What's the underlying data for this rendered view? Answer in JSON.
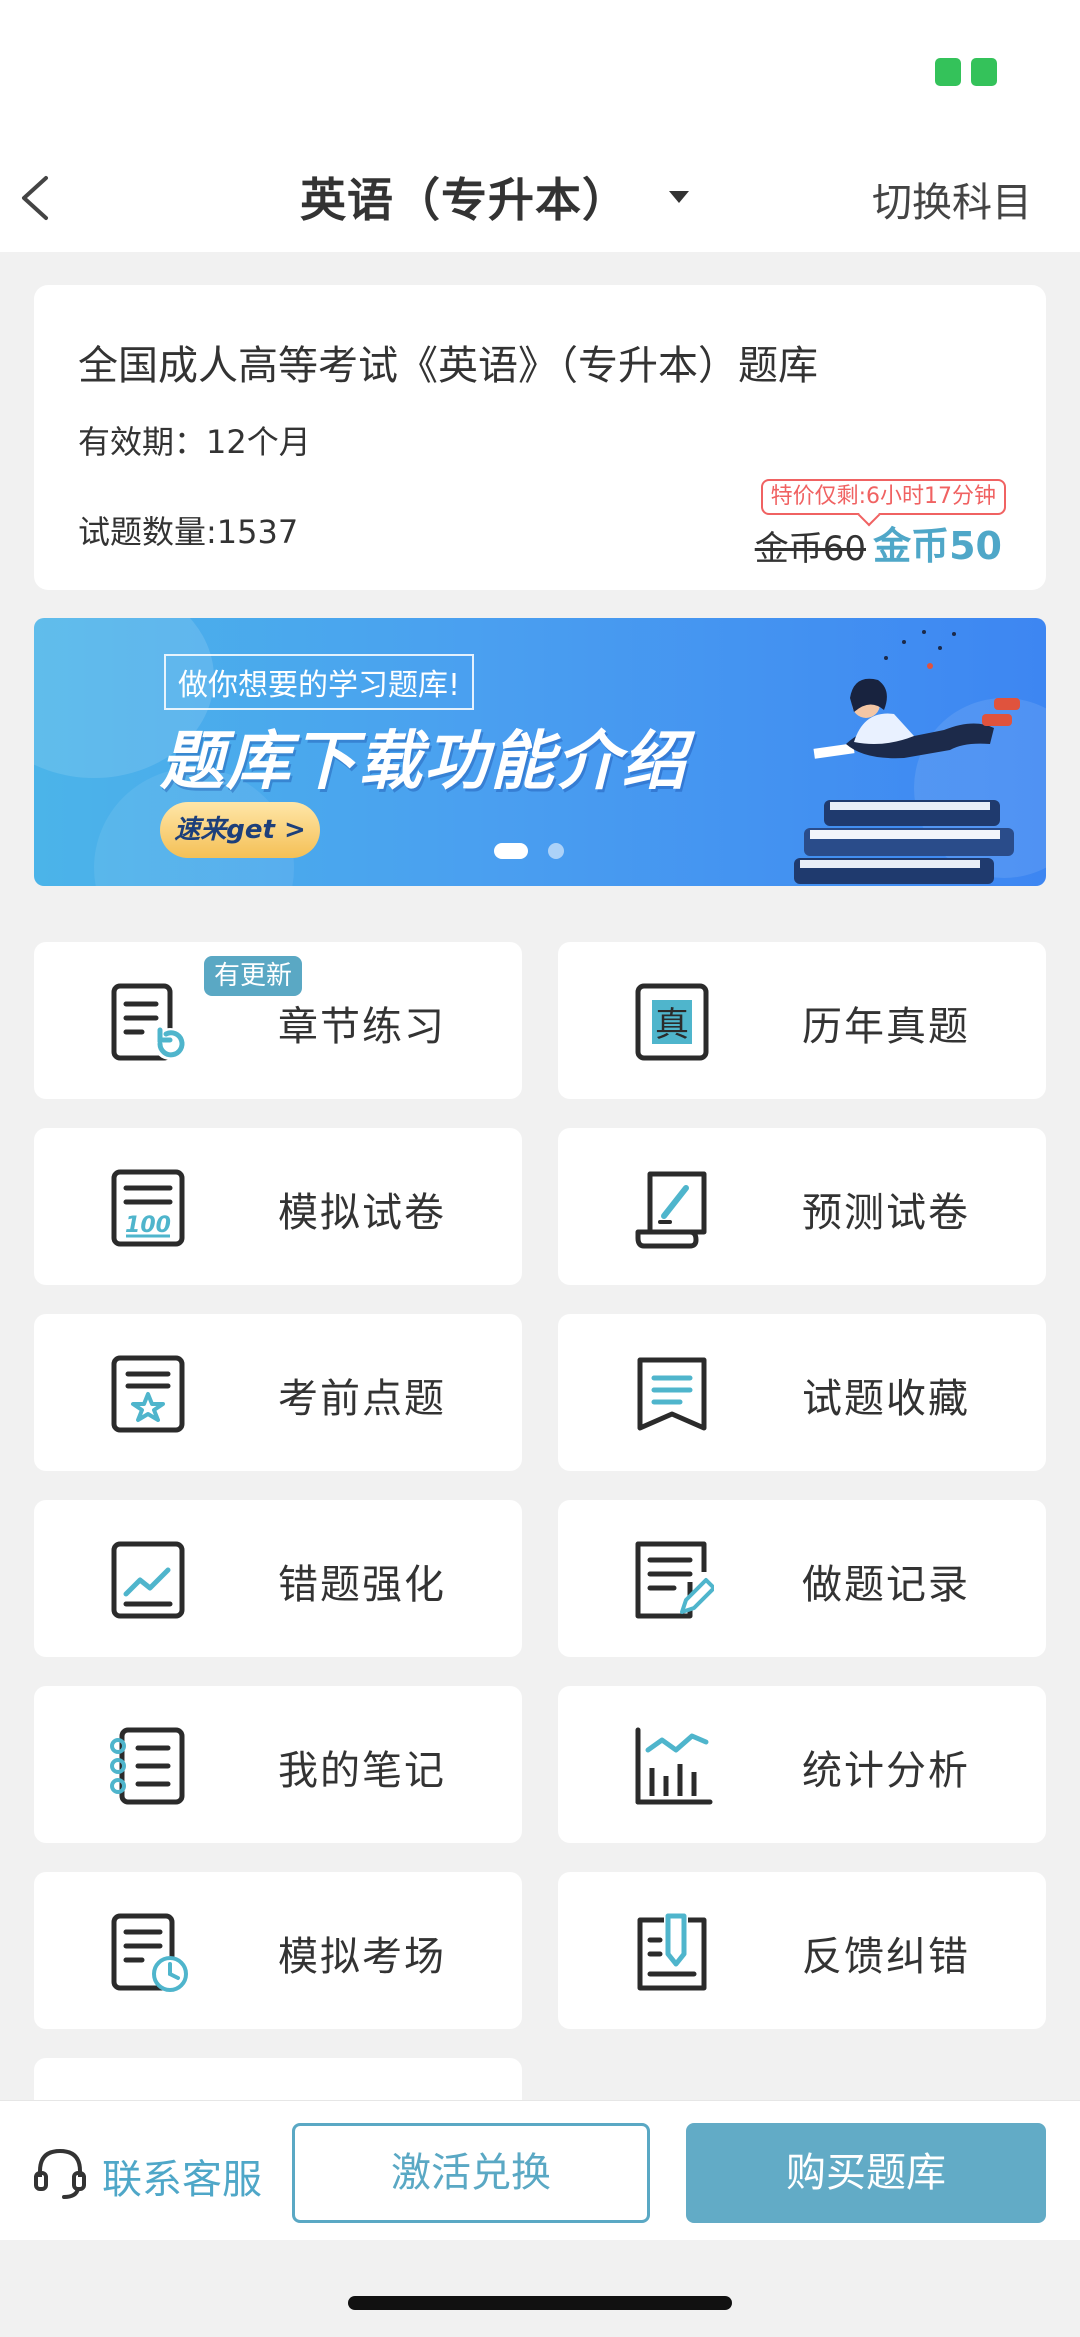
{
  "nav": {
    "title": "英语（专升本）",
    "switch_label": "切换科目"
  },
  "card": {
    "title": "全国成人高等考试《英语》（专升本）题库",
    "validity": "有效期：12个月",
    "count": "试题数量:1537",
    "promo": "特价仅剩:6小时17分钟",
    "old_price": "金币60",
    "new_price": "金币50"
  },
  "banner": {
    "subtitle": "做你想要的学习题库!",
    "headline": "题库下载功能介绍",
    "cta": "速来get >",
    "page_count": 2,
    "active_page": 1
  },
  "badge_update": "有更新",
  "tiles": [
    {
      "label": "章节练习",
      "icon": "chapter-practice-icon"
    },
    {
      "label": "历年真题",
      "icon": "past-exams-icon"
    },
    {
      "label": "模拟试卷",
      "icon": "mock-paper-icon"
    },
    {
      "label": "预测试卷",
      "icon": "predict-paper-icon"
    },
    {
      "label": "考前点题",
      "icon": "pre-exam-tips-icon"
    },
    {
      "label": "试题收藏",
      "icon": "bookmark-icon"
    },
    {
      "label": "错题强化",
      "icon": "wrong-questions-icon"
    },
    {
      "label": "做题记录",
      "icon": "practice-record-icon"
    },
    {
      "label": "我的笔记",
      "icon": "notes-icon"
    },
    {
      "label": "统计分析",
      "icon": "statistics-icon"
    },
    {
      "label": "模拟考场",
      "icon": "mock-exam-room-icon"
    },
    {
      "label": "反馈纠错",
      "icon": "feedback-icon"
    }
  ],
  "bottom": {
    "service_label": "联系客服",
    "activate_label": "激活兑换",
    "buy_label": "购买题库"
  },
  "colors": {
    "accent": "#5aa8c4",
    "price": "#4fa7c8",
    "promo": "#f06262",
    "status_chip": "#34c25a"
  }
}
